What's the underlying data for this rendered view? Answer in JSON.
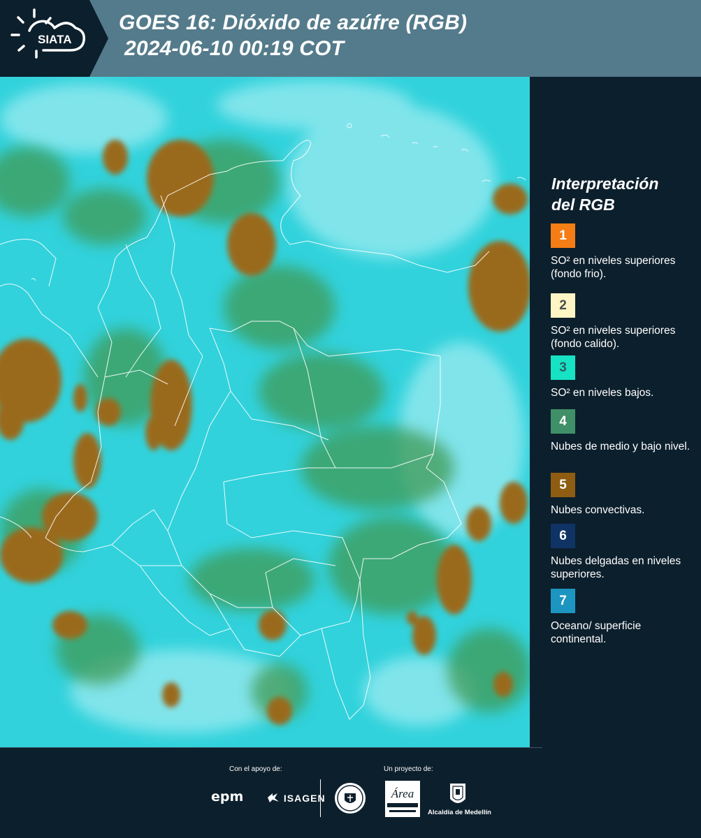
{
  "header": {
    "logo_text": "SIATA",
    "title_line1": "GOES 16: Dióxido de azúfre (RGB)",
    "title_line2": "2024-06-10 00:19 COT"
  },
  "legend": {
    "title_line1": "Interpretación",
    "title_line2": "del RGB",
    "items": [
      {
        "number": "1",
        "label": "SO² en niveles superiores (fondo frio).",
        "color": "#f57d15",
        "num_color": "#ffffff"
      },
      {
        "number": "2",
        "label": "SO² en niveles superiores (fondo calido).",
        "color": "#fdf5c4",
        "num_color": "#4b4b4b"
      },
      {
        "number": "3",
        "label": "SO² en niveles bajos.",
        "color": "#16e3c4",
        "num_color": "#2e5e64"
      },
      {
        "number": "4",
        "label": "Nubes de medio y bajo nivel.",
        "color": "#3f9068",
        "num_color": "#ffffff"
      },
      {
        "number": "5",
        "label": "Nubes convectivas.",
        "color": "#8e5d12",
        "num_color": "#ffffff"
      },
      {
        "number": "6",
        "label": "Nubes delgadas en niveles superiores.",
        "color": "#0f3365",
        "num_color": "#ffffff"
      },
      {
        "number": "7",
        "label": "Oceano/ superficie continental.",
        "color": "#1c96c0",
        "num_color": "#ffffff"
      }
    ]
  },
  "footer": {
    "support_label": "Con el apoyo de:",
    "project_label": "Un proyecto de:",
    "sponsor1": "epm",
    "sponsor2": "ISAGEN",
    "partner1": "Área Metropolitana",
    "partner2": "Alcaldía de Medellín"
  }
}
